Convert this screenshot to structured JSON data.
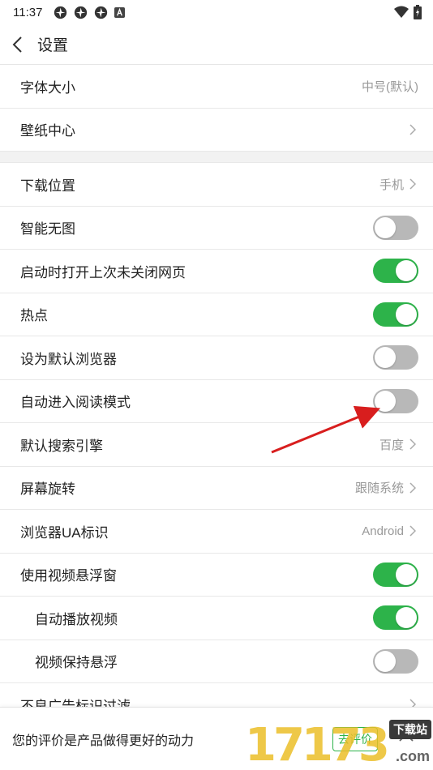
{
  "status_bar": {
    "time": "11:37"
  },
  "header": {
    "title": "设置"
  },
  "section1": [
    {
      "label": "字体大小",
      "value": "中号(默认)"
    },
    {
      "label": "壁纸中心"
    }
  ],
  "section2": {
    "download": {
      "label": "下载位置",
      "value": "手机"
    },
    "smart_no_image": {
      "label": "智能无图",
      "on": false
    },
    "restore_tabs": {
      "label": "启动时打开上次未关闭网页",
      "on": true
    },
    "hotspot": {
      "label": "热点",
      "on": true
    },
    "default_browser": {
      "label": "设为默认浏览器",
      "on": false
    },
    "reading_mode": {
      "label": "自动进入阅读模式",
      "on": false
    },
    "search_engine": {
      "label": "默认搜索引擎",
      "value": "百度"
    },
    "rotation": {
      "label": "屏幕旋转",
      "value": "跟随系统"
    },
    "ua": {
      "label": "浏览器UA标识",
      "value": "Android"
    },
    "floating_video": {
      "label": "使用视频悬浮窗",
      "on": true
    },
    "autoplay": {
      "label": "自动播放视频",
      "on": true
    },
    "keep_floating": {
      "label": "视频保持悬浮",
      "on": false
    },
    "ad_filter": {
      "label": "不良广告标识过滤"
    }
  },
  "bottom_bar": {
    "text": "您的评价是产品做得更好的动力",
    "rate_label": "去评价"
  },
  "watermark": {
    "number": "17173",
    "tag": "下载站",
    "domain": ".com"
  },
  "colors": {
    "accent": "#2db34a",
    "toggle_off": "#b8b8b8",
    "arrow": "#d81e1e"
  }
}
